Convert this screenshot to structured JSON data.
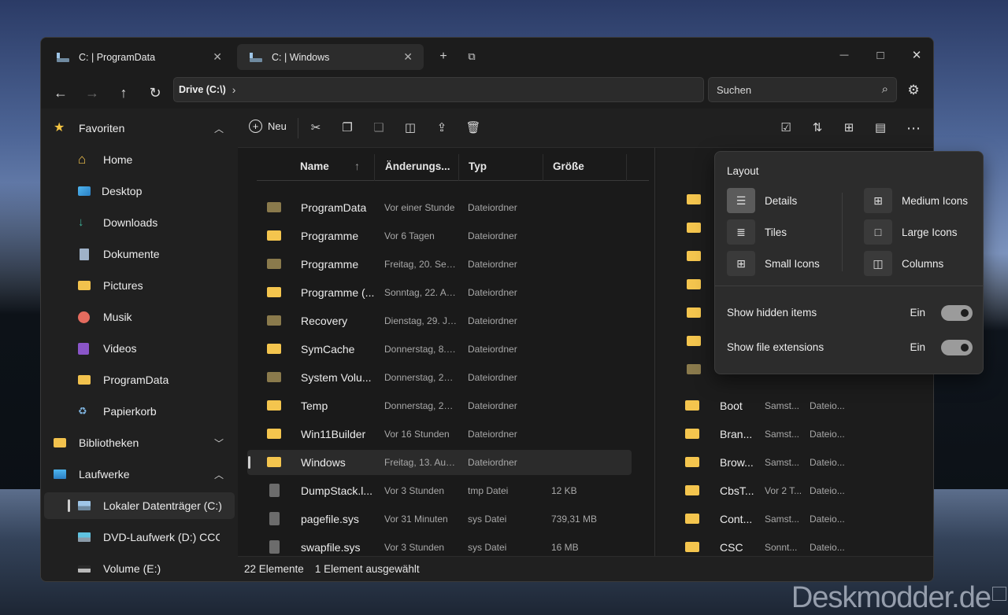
{
  "tabs": [
    {
      "label": "C: | ProgramData"
    },
    {
      "label": "C: | Windows"
    }
  ],
  "titlebar": {
    "new_tab": "+",
    "duplicate": "⧉",
    "minimize": "—",
    "maximize": "□",
    "close": "✕"
  },
  "navigation": {
    "back": "←",
    "forward": "→",
    "up": "↑",
    "refresh": "↻"
  },
  "address": {
    "crumb": "Drive (C:\\)",
    "separator": "›"
  },
  "search": {
    "placeholder": "Suchen"
  },
  "sidebar": {
    "favorites": {
      "label": "Favoriten"
    },
    "items": [
      {
        "label": "Home"
      },
      {
        "label": "Desktop"
      },
      {
        "label": "Downloads"
      },
      {
        "label": "Dokumente"
      },
      {
        "label": "Pictures"
      },
      {
        "label": "Musik"
      },
      {
        "label": "Videos"
      },
      {
        "label": "ProgramData"
      },
      {
        "label": "Papierkorb"
      }
    ],
    "libraries": {
      "label": "Bibliotheken"
    },
    "drives": {
      "label": "Laufwerke"
    },
    "drive_items": [
      {
        "label": "Lokaler Datenträger (C:)"
      },
      {
        "label": "DVD-Laufwerk (D:) CCCC"
      },
      {
        "label": "Volume (E:)"
      }
    ]
  },
  "toolbar": {
    "new_label": "Neu"
  },
  "columns": {
    "name": "Name",
    "modified": "Änderungs...",
    "type": "Typ",
    "size": "Größe"
  },
  "files": [
    {
      "name": "ProgramData",
      "date": "Vor einer Stunde",
      "type": "Dateiordner",
      "size": "",
      "kind": "folder-dim"
    },
    {
      "name": "Programme",
      "date": "Vor 6 Tagen",
      "type": "Dateiordner",
      "size": "",
      "kind": "folder"
    },
    {
      "name": "Programme",
      "date": "Freitag, 20. Sept...",
      "type": "Dateiordner",
      "size": "",
      "kind": "folder-dim"
    },
    {
      "name": "Programme (...",
      "date": "Sonntag, 22. Au...",
      "type": "Dateiordner",
      "size": "",
      "kind": "folder"
    },
    {
      "name": "Recovery",
      "date": "Dienstag, 29. Ju...",
      "type": "Dateiordner",
      "size": "",
      "kind": "folder-dim"
    },
    {
      "name": "SymCache",
      "date": "Donnerstag, 8. J...",
      "type": "Dateiordner",
      "size": "",
      "kind": "folder"
    },
    {
      "name": "System Volu...",
      "date": "Donnerstag, 25....",
      "type": "Dateiordner",
      "size": "",
      "kind": "folder-dim"
    },
    {
      "name": "Temp",
      "date": "Donnerstag, 25....",
      "type": "Dateiordner",
      "size": "",
      "kind": "folder"
    },
    {
      "name": "Win11Builder",
      "date": "Vor 16 Stunden",
      "type": "Dateiordner",
      "size": "",
      "kind": "folder"
    },
    {
      "name": "Windows",
      "date": "Freitag, 13. Aug...",
      "type": "Dateiordner",
      "size": "",
      "kind": "folder"
    },
    {
      "name": "DumpStack.l...",
      "date": "Vor 3 Stunden",
      "type": "tmp Datei",
      "size": "12 KB",
      "kind": "file"
    },
    {
      "name": "pagefile.sys",
      "date": "Vor 31 Minuten",
      "type": "sys Datei",
      "size": "739,31 MB",
      "kind": "file"
    },
    {
      "name": "swapfile.sys",
      "date": "Vor 3 Stunden",
      "type": "sys Datei",
      "size": "16 MB",
      "kind": "file"
    }
  ],
  "pane2_files": [
    {
      "name": "Boot",
      "date": "Samst...",
      "type": "Dateio..."
    },
    {
      "name": "Bran...",
      "date": "Samst...",
      "type": "Dateio..."
    },
    {
      "name": "Brow...",
      "date": "Samst...",
      "type": "Dateio..."
    },
    {
      "name": "CbsT...",
      "date": "Vor 2 T...",
      "type": "Dateio..."
    },
    {
      "name": "Cont...",
      "date": "Samst...",
      "type": "Dateio..."
    },
    {
      "name": "CSC",
      "date": "Sonnt...",
      "type": "Dateio..."
    }
  ],
  "status": {
    "count": "22 Elemente",
    "selection": "1 Element ausgewählt"
  },
  "layout_popup": {
    "title": "Layout",
    "options": {
      "details": "Details",
      "tiles": "Tiles",
      "small_icons": "Small Icons",
      "medium_icons": "Medium Icons",
      "large_icons": "Large Icons",
      "columns": "Columns"
    },
    "hidden_items": {
      "label": "Show hidden items",
      "state": "Ein"
    },
    "extensions": {
      "label": "Show file extensions",
      "state": "Ein"
    }
  },
  "watermark": "Deskmodder.de"
}
